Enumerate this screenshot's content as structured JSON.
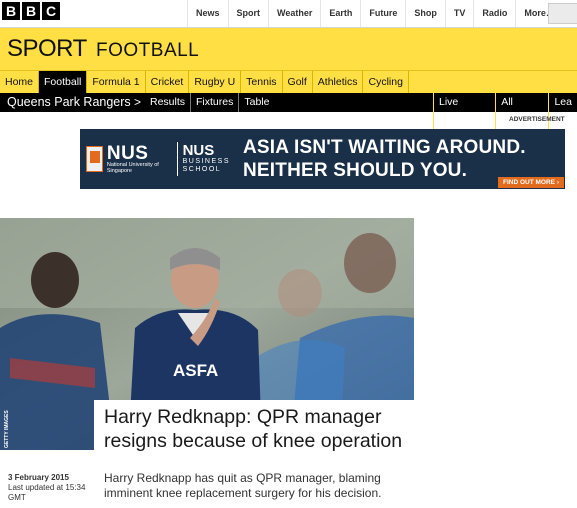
{
  "bbc": {
    "logo_letters": [
      "B",
      "B",
      "C"
    ],
    "nav": [
      "News",
      "Sport",
      "Weather",
      "Earth",
      "Future",
      "Shop",
      "TV",
      "Radio",
      "More…"
    ]
  },
  "sport": {
    "title": "SPORT",
    "section": "FOOTBALL",
    "nav": [
      "Home",
      "Football",
      "Formula 1",
      "Cricket",
      "Rugby U",
      "Tennis",
      "Golf",
      "Athletics",
      "Cycling"
    ],
    "active": "Football"
  },
  "team_bar": {
    "team": "Queens Park Rangers",
    "chevron": ">",
    "links": [
      "Results",
      "Fixtures",
      "Table"
    ],
    "right_links": [
      "Live Scores",
      "All Teams",
      "Lea"
    ]
  },
  "ad": {
    "label": "ADVERTISEMENT",
    "nus_big": "NUS",
    "nus_small": "National University of Singapore",
    "bs_big": "NUS",
    "bs_line1": "BUSINESS",
    "bs_line2": "SCHOOL",
    "headline_1": "ASIA ISN'T WAITING AROUND.",
    "headline_2": "NEITHER SHOULD YOU.",
    "cta": "FIND OUT MORE ›"
  },
  "article": {
    "photo_credit": "GETTY IMAGES",
    "shirt_text": "ASFA",
    "headline": "Harry Redknapp: QPR manager resigns because of knee operation",
    "date": "3 February 2015",
    "updated": "Last updated at 15:34 GMT",
    "summary": "Harry Redknapp has quit as QPR manager, blaming imminent knee replacement surgery for his decision."
  },
  "colors": {
    "sport_yellow": "#ffdf43",
    "ad_navy": "#1a2f48",
    "ad_orange": "#e36b1d"
  }
}
